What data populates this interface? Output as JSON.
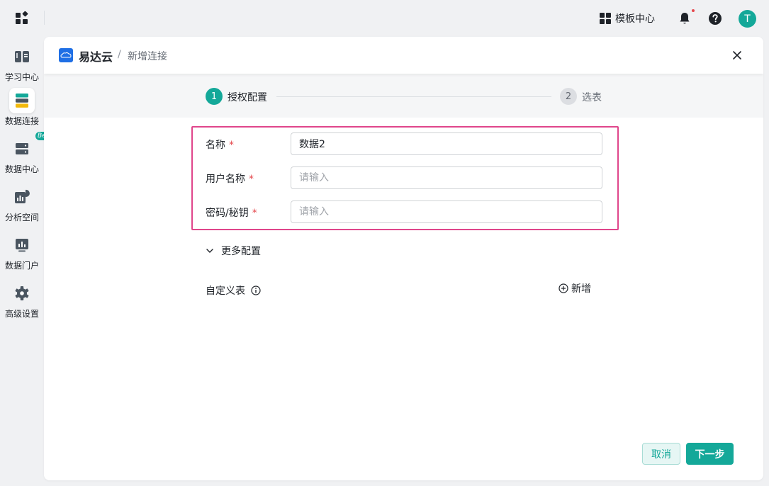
{
  "topbar": {
    "template_center_label": "模板中心",
    "avatar_letter": "T"
  },
  "sidebar": {
    "items": [
      {
        "label": "学习中心",
        "icon": "learning-center-icon",
        "active": false
      },
      {
        "label": "数据连接",
        "icon": "data-connection-icon",
        "active": true
      },
      {
        "label": "数据中心",
        "icon": "data-center-icon",
        "active": false,
        "badge": "Beta"
      },
      {
        "label": "分析空间",
        "icon": "analysis-space-icon",
        "active": false
      },
      {
        "label": "数据门户",
        "icon": "data-portal-icon",
        "active": false
      },
      {
        "label": "高级设置",
        "icon": "gear-icon",
        "active": false
      }
    ]
  },
  "header": {
    "brand": "易达云",
    "separator": "/",
    "crumb": "新增连接"
  },
  "steps": [
    {
      "number": "1",
      "label": "授权配置",
      "active": true
    },
    {
      "number": "2",
      "label": "选表",
      "active": false
    }
  ],
  "form": {
    "required_mark": "*",
    "fields": [
      {
        "label": "名称",
        "value": "数据2",
        "placeholder": ""
      },
      {
        "label": "用户名称",
        "value": "",
        "placeholder": "请输入"
      },
      {
        "label": "密码/秘钥",
        "value": "",
        "placeholder": "请输入"
      }
    ],
    "more_config": "更多配置",
    "custom_table_label": "自定义表",
    "add_label": "新增"
  },
  "footer": {
    "cancel_label": "取消",
    "next_label": "下一步"
  },
  "colors": {
    "accent": "#14a899",
    "highlight_border": "#e0468b",
    "required": "#e5484d"
  }
}
